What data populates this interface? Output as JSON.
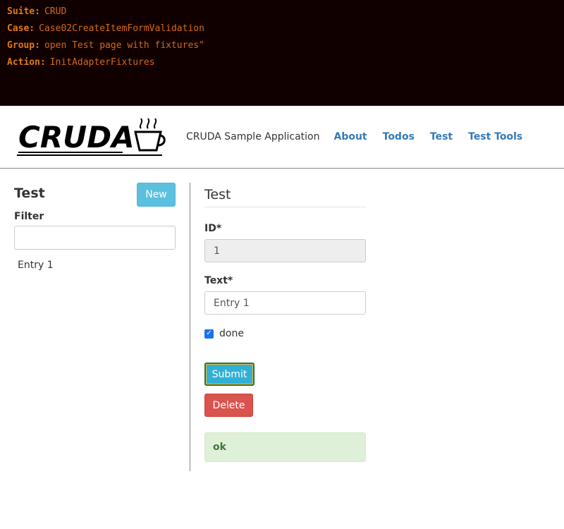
{
  "console": {
    "rows": [
      {
        "key": "Suite:",
        "value": "CRUD"
      },
      {
        "key": "Case:",
        "value": "Case02CreateItemFormValidation"
      },
      {
        "key": "Group:",
        "value": "open Test page with fixtures\""
      },
      {
        "key": "Action:",
        "value": "InitAdapterFixtures"
      }
    ]
  },
  "navbar": {
    "logo_text": "CRUDA",
    "logo_icon": "coffee-cup-icon",
    "brand": "CRUDA Sample Application",
    "links": [
      "About",
      "Todos",
      "Test",
      "Test Tools"
    ]
  },
  "sidebar": {
    "title": "Test",
    "new_button": "New",
    "filter_label": "Filter",
    "filter_value": "",
    "entries": [
      "Entry 1"
    ]
  },
  "form": {
    "title": "Test",
    "id_label": "ID*",
    "id_value": "1",
    "text_label": "Text*",
    "text_value": "Entry 1",
    "done_label": "done",
    "done_checked": true,
    "submit_label": "Submit",
    "delete_label": "Delete",
    "status_message": "ok"
  },
  "colors": {
    "console_bg": "#110000",
    "console_text": "#e07a1a",
    "link": "#337ab7",
    "info": "#5bc0de",
    "danger": "#d9534f",
    "success_bg": "#dff0d8",
    "success_text": "#3c763d"
  }
}
